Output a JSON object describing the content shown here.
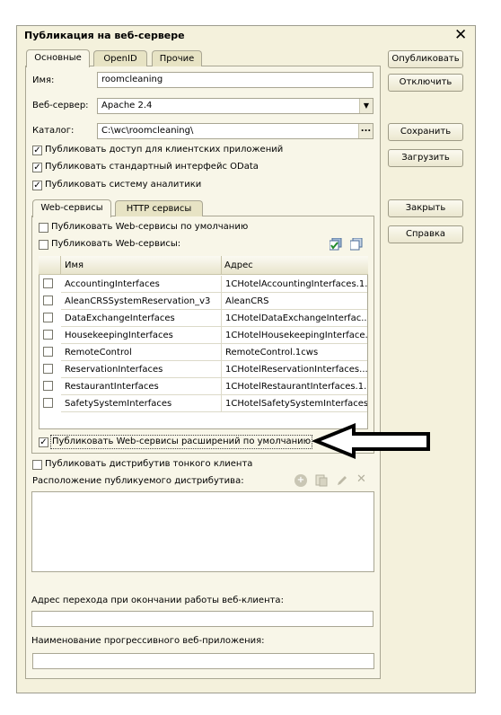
{
  "window": {
    "title": "Публикация на веб-сервере",
    "close_icon": "close-icon"
  },
  "tabs": [
    "Основные",
    "OpenID",
    "Прочие"
  ],
  "fields": {
    "name_label": "Имя:",
    "name_value": "roomcleaning",
    "server_label": "Веб-сервер:",
    "server_value": "Apache 2.4",
    "catalog_label": "Каталог:",
    "catalog_value": "C:\\wc\\roomcleaning\\",
    "browse_label": "..."
  },
  "options": [
    "Публиковать доступ для клиентских приложений",
    "Публиковать стандартный интерфейс OData",
    "Публиковать систему аналитики"
  ],
  "inner_tabs": [
    "Web-сервисы",
    "HTTP сервисы"
  ],
  "ws": {
    "default_label": "Публиковать Web-сервисы по умолчанию",
    "publish_label": "Публиковать Web-сервисы:",
    "columns": [
      "Имя",
      "Адрес"
    ],
    "rows": [
      {
        "name": "AccountingInterfaces",
        "address": "1CHotelAccountingInterfaces.1..."
      },
      {
        "name": "AleanCRSSystemReservation_v3",
        "address": "AleanCRS"
      },
      {
        "name": "DataExchangeInterfaces",
        "address": "1CHotelDataExchangeInterfac..."
      },
      {
        "name": "HousekeepingInterfaces",
        "address": "1CHotelHousekeepingInterface..."
      },
      {
        "name": "RemoteControl",
        "address": "RemoteControl.1cws"
      },
      {
        "name": "ReservationInterfaces",
        "address": "1CHotelReservationInterfaces...."
      },
      {
        "name": "RestaurantInterfaces",
        "address": "1CHotelRestaurantInterfaces.1..."
      },
      {
        "name": "SafetySystemInterfaces",
        "address": "1CHotelSafetySystemInterfaces...."
      }
    ],
    "extensions_label": "Публиковать Web-сервисы расширений по умолчанию"
  },
  "thin_client_label": "Публиковать дистрибутив тонкого клиента",
  "distr_location_label": "Расположение публикуемого дистрибутива:",
  "exit_url_label": "Адрес перехода при окончании работы веб-клиента:",
  "pwa_name_label": "Наименование прогрессивного веб-приложения:",
  "buttons": {
    "publish": "Опубликовать",
    "unpublish": "Отключить",
    "save": "Сохранить",
    "load": "Загрузить",
    "close": "Закрыть",
    "help": "Справка"
  }
}
